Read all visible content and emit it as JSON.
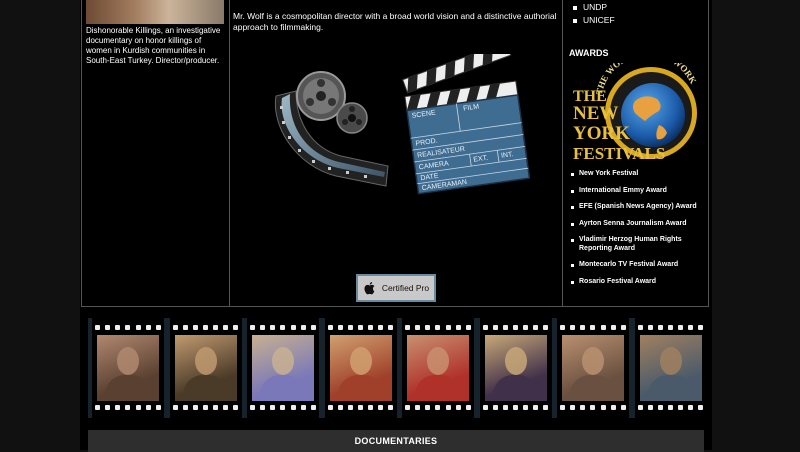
{
  "left": {
    "description": "Dishonorable Killings, an investigative documentary on honor killings of women in Kurdish communities in South-East Turkey. Director/producer."
  },
  "middle": {
    "bio": "Mr. Wolf is a cosmopolitan director with a broad world vision and a distinctive authorial approach to filmmaking.",
    "clapper": {
      "scene": "SCENE",
      "film": "FILM",
      "prod": "PROD.",
      "realisateur": "REALISATEUR",
      "camera": "CAMERA",
      "ext": "EXT.",
      "int": "INT.",
      "date": "DATE",
      "cameraman": "CAMERAMAN"
    },
    "certified_label": "Certified Pro"
  },
  "right": {
    "clients": [
      "UNDP",
      "UNICEF"
    ],
    "awards_title": "AWARDS",
    "logo_text": {
      "the": "THE",
      "line1": "NEW",
      "line2": "YORK",
      "line3": "FESTIVALS",
      "arc": "THE WORLD'S BEST WORK"
    },
    "awards": [
      "New York Festival",
      "International Emmy Award",
      "EFE (Spanish News Agency) Award",
      "Ayrton Senna Journalism Award",
      "Vladimir Herzog Human Rights Reporting Award",
      "Montecarlo TV Festival Award",
      "Rosario Festival Award"
    ]
  },
  "filmstrip": {
    "frames": [
      {
        "icon": "portrait-woman-dark-hair",
        "colors": [
          "#5a4030",
          "#b08870"
        ]
      },
      {
        "icon": "portrait-woman-hat",
        "colors": [
          "#4a3a28",
          "#c09a70"
        ]
      },
      {
        "icon": "portrait-burqa",
        "colors": [
          "#7a78b8",
          "#c8b090"
        ]
      },
      {
        "icon": "portrait-smiling-man",
        "colors": [
          "#a0402a",
          "#d0a070"
        ]
      },
      {
        "icon": "portrait-woman-red-robe",
        "colors": [
          "#b0302a",
          "#c89070"
        ]
      },
      {
        "icon": "portrait-veiled-woman",
        "colors": [
          "#40304a",
          "#c8a878"
        ]
      },
      {
        "icon": "portrait-profile-woman",
        "colors": [
          "#6a5040",
          "#b89070"
        ]
      },
      {
        "icon": "portrait-woman-outdoors",
        "colors": [
          "#4a5a6a",
          "#a08060"
        ]
      }
    ]
  },
  "bottom": {
    "section_title": "DOCUMENTARIES"
  }
}
